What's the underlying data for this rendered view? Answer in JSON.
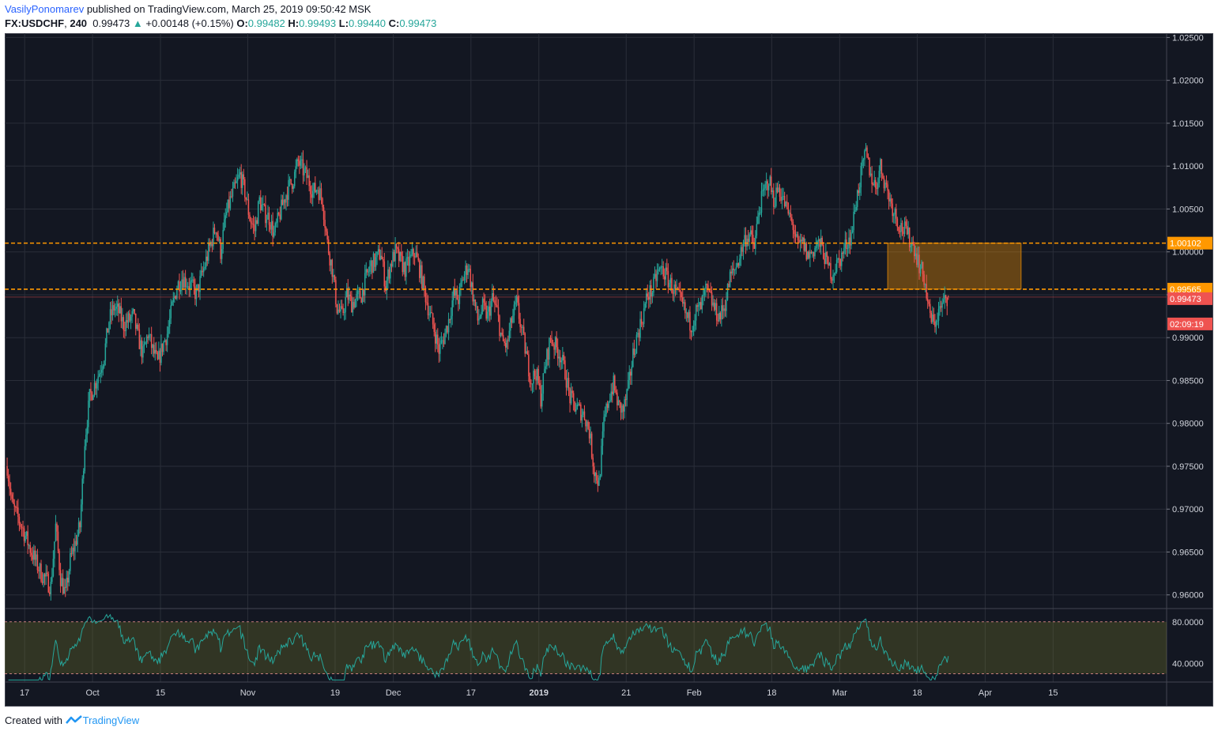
{
  "header": {
    "author": "VasilyPonomarev",
    "published_text": "published on TradingView.com, March 25, 2019 09:50:42 MSK",
    "symbol": "FX:USDCHF",
    "interval": "240",
    "last": "0.99473",
    "change_arrow": "▲",
    "change": "+0.00148 (+0.15%)",
    "open_label": "O:",
    "open": "0.99482",
    "high_label": "H:",
    "high": "0.99493",
    "low_label": "L:",
    "low": "0.99440",
    "close_label": "C:",
    "close": "0.99473"
  },
  "footer": {
    "created_with": "Created with",
    "brand": "TradingView"
  },
  "colors": {
    "background": "#131722",
    "up": "#26a69a",
    "down": "#ef5350",
    "level": "#ff9800",
    "grid": "#2a2e39",
    "axis_text": "#d1d4dc",
    "rsi_line": "#26a69a"
  },
  "chart_data": {
    "type": "candlestick",
    "symbol": "FX:USDCHF",
    "interval": "240",
    "ylim": [
      0.9585,
      1.0255
    ],
    "y_ticks": [
      "1.02500",
      "1.02000",
      "1.01500",
      "1.01000",
      "1.00500",
      "1.00000",
      "0.99500",
      "0.99000",
      "0.98500",
      "0.98000",
      "0.97500",
      "0.97000",
      "0.96500",
      "0.96000"
    ],
    "y_tick_values": [
      1.025,
      1.02,
      1.015,
      1.01,
      1.005,
      1.0,
      0.995,
      0.99,
      0.985,
      0.98,
      0.975,
      0.97,
      0.965,
      0.96
    ],
    "x_ticks": [
      {
        "label": "17",
        "t": 0.6
      },
      {
        "label": "Oct",
        "t": 14.6
      },
      {
        "label": "15",
        "t": 28.6
      },
      {
        "label": "Nov",
        "t": 46.6
      },
      {
        "label": "19",
        "t": 64.6
      },
      {
        "label": "Dec",
        "t": 76.6
      },
      {
        "label": "17",
        "t": 92.6
      },
      {
        "label": "2019",
        "t": 106.6,
        "bold": true
      },
      {
        "label": "21",
        "t": 124.6
      },
      {
        "label": "Feb",
        "t": 138.6
      },
      {
        "label": "18",
        "t": 154.6
      },
      {
        "label": "Mar",
        "t": 168.6
      },
      {
        "label": "18",
        "t": 184.6
      },
      {
        "label": "Apr",
        "t": 198.6
      },
      {
        "label": "15",
        "t": 212.6
      }
    ],
    "x_range": [
      -3.5,
      236
    ],
    "close_path": [
      [
        -3,
        0.975
      ],
      [
        -2,
        0.9705
      ],
      [
        0,
        0.968
      ],
      [
        2,
        0.965
      ],
      [
        4,
        0.9625
      ],
      [
        6,
        0.961
      ],
      [
        7,
        0.968
      ],
      [
        8,
        0.962
      ],
      [
        9,
        0.96
      ],
      [
        10,
        0.964
      ],
      [
        11,
        0.966
      ],
      [
        12,
        0.968
      ],
      [
        13,
        0.978
      ],
      [
        14,
        0.983
      ],
      [
        15,
        0.9845
      ],
      [
        16,
        0.986
      ],
      [
        17,
        0.988
      ],
      [
        18,
        0.992
      ],
      [
        19,
        0.9935
      ],
      [
        20,
        0.993
      ],
      [
        21,
        0.9915
      ],
      [
        22,
        0.992
      ],
      [
        23,
        0.9925
      ],
      [
        24,
        0.99
      ],
      [
        25,
        0.988
      ],
      [
        26,
        0.9905
      ],
      [
        27,
        0.9885
      ],
      [
        28,
        0.987
      ],
      [
        29,
        0.989
      ],
      [
        30,
        0.9905
      ],
      [
        31,
        0.9935
      ],
      [
        32,
        0.996
      ],
      [
        33,
        0.997
      ],
      [
        34,
        0.9965
      ],
      [
        35,
        0.996
      ],
      [
        36,
        0.995
      ],
      [
        37,
        0.997
      ],
      [
        38,
        0.999
      ],
      [
        39,
        1.001
      ],
      [
        40,
        1.003
      ],
      [
        41,
        1.0
      ],
      [
        42,
        1.004
      ],
      [
        43,
        1.006
      ],
      [
        44,
        1.0075
      ],
      [
        45,
        1.009
      ],
      [
        46,
        1.007
      ],
      [
        47,
        1.004
      ],
      [
        48,
        1.0025
      ],
      [
        49,
        1.006
      ],
      [
        50,
        1.0045
      ],
      [
        51,
        1.004
      ],
      [
        52,
        1.002
      ],
      [
        53,
        1.004
      ],
      [
        54,
        1.006
      ],
      [
        55,
        1.0075
      ],
      [
        56,
        1.0085
      ],
      [
        57,
        1.0105
      ],
      [
        58,
        1.0095
      ],
      [
        59,
        1.0085
      ],
      [
        60,
        1.007
      ],
      [
        61,
        1.0075
      ],
      [
        62,
        1.006
      ],
      [
        63,
        1.001
      ],
      [
        64,
        0.998
      ],
      [
        65,
        0.9935
      ],
      [
        66,
        0.9925
      ],
      [
        67,
        0.995
      ],
      [
        68,
        0.994
      ],
      [
        69,
        0.9945
      ],
      [
        70,
        0.995
      ],
      [
        71,
        0.997
      ],
      [
        72,
        0.9985
      ],
      [
        73,
        0.999
      ],
      [
        74,
        1.0
      ],
      [
        75,
        0.996
      ],
      [
        76,
        0.9985
      ],
      [
        77,
        1.0
      ],
      [
        78,
        0.999
      ],
      [
        79,
        0.998
      ],
      [
        80,
        0.999
      ],
      [
        81,
        1.0
      ],
      [
        82,
        0.998
      ],
      [
        83,
        0.9955
      ],
      [
        84,
        0.993
      ],
      [
        85,
        0.991
      ],
      [
        86,
        0.9885
      ],
      [
        87,
        0.99
      ],
      [
        88,
        0.992
      ],
      [
        89,
        0.995
      ],
      [
        90,
        0.9945
      ],
      [
        91,
        0.997
      ],
      [
        92,
        0.9985
      ],
      [
        93,
        0.995
      ],
      [
        94,
        0.992
      ],
      [
        95,
        0.9935
      ],
      [
        96,
        0.9925
      ],
      [
        97,
        0.9945
      ],
      [
        98,
        0.993
      ],
      [
        99,
        0.9895
      ],
      [
        100,
        0.989
      ],
      [
        101,
        0.992
      ],
      [
        102,
        0.994
      ],
      [
        103,
        0.991
      ],
      [
        104,
        0.988
      ],
      [
        105,
        0.985
      ],
      [
        106,
        0.986
      ],
      [
        107,
        0.983
      ],
      [
        108,
        0.987
      ],
      [
        109,
        0.99
      ],
      [
        110,
        0.989
      ],
      [
        111,
        0.988
      ],
      [
        112,
        0.986
      ],
      [
        113,
        0.983
      ],
      [
        114,
        0.982
      ],
      [
        115,
        0.9815
      ],
      [
        116,
        0.981
      ],
      [
        117,
        0.979
      ],
      [
        118,
        0.9745
      ],
      [
        119,
        0.973
      ],
      [
        120,
        0.98
      ],
      [
        121,
        0.983
      ],
      [
        122,
        0.9845
      ],
      [
        123,
        0.982
      ],
      [
        124,
        0.9815
      ],
      [
        125,
        0.984
      ],
      [
        126,
        0.988
      ],
      [
        127,
        0.9905
      ],
      [
        128,
        0.9925
      ],
      [
        129,
        0.995
      ],
      [
        130,
        0.9955
      ],
      [
        131,
        0.9975
      ],
      [
        132,
        0.998
      ],
      [
        133,
        0.997
      ],
      [
        134,
        0.996
      ],
      [
        135,
        0.995
      ],
      [
        136,
        0.994
      ],
      [
        137,
        0.9925
      ],
      [
        138,
        0.9915
      ],
      [
        139,
        0.993
      ],
      [
        140,
        0.9935
      ],
      [
        141,
        0.9955
      ],
      [
        142,
        0.9945
      ],
      [
        143,
        0.993
      ],
      [
        144,
        0.9925
      ],
      [
        145,
        0.994
      ],
      [
        146,
        0.997
      ],
      [
        147,
        0.998
      ],
      [
        148,
        0.9995
      ],
      [
        149,
        1.0015
      ],
      [
        150,
        1.002
      ],
      [
        151,
        1.0005
      ],
      [
        152,
        1.005
      ],
      [
        153,
        1.007
      ],
      [
        154,
        1.0085
      ],
      [
        155,
        1.006
      ],
      [
        156,
        1.0075
      ],
      [
        157,
        1.006
      ],
      [
        158,
        1.0045
      ],
      [
        159,
        1.003
      ],
      [
        160,
        1.0005
      ],
      [
        161,
        1.001
      ],
      [
        162,
        0.9995
      ],
      [
        163,
        1.0
      ],
      [
        164,
        1.001
      ],
      [
        165,
        1.0005
      ],
      [
        166,
        0.9985
      ],
      [
        167,
        0.9975
      ],
      [
        168,
        0.9985
      ],
      [
        169,
        0.9995
      ],
      [
        170,
        1.001
      ],
      [
        171,
        1.002
      ],
      [
        172,
        1.006
      ],
      [
        173,
        1.009
      ],
      [
        174,
        1.0115
      ],
      [
        175,
        1.009
      ],
      [
        176,
        1.0075
      ],
      [
        177,
        1.01
      ],
      [
        178,
        1.008
      ],
      [
        179,
        1.006
      ],
      [
        180,
        1.0045
      ],
      [
        181,
        1.003
      ],
      [
        182,
        1.0025
      ],
      [
        183,
        1.0015
      ],
      [
        184,
        1.0005
      ],
      [
        185,
        0.9985
      ],
      [
        186,
        0.997
      ],
      [
        187,
        0.993
      ],
      [
        188,
        0.9915
      ],
      [
        189,
        0.993
      ],
      [
        190,
        0.994
      ],
      [
        191,
        0.9947
      ]
    ],
    "levels": [
      {
        "value": 1.00102,
        "label": "1.00102",
        "color": "#ff9800"
      },
      {
        "value": 0.99565,
        "label": "0.99565",
        "color": "#ff9800"
      }
    ],
    "current_price": {
      "value": 0.99473,
      "label": "0.99473",
      "countdown": "02:09:19",
      "color": "#ef5350"
    },
    "zone": {
      "t_start": 178.5,
      "t_end": 206.0,
      "top": 1.00102,
      "bottom": 0.99565,
      "color": "#ff9800"
    },
    "rsi": {
      "upper_band": 80,
      "lower_band": 30,
      "ylim": [
        22,
        92
      ],
      "y_ticks": [
        "80.0000",
        "40.0000"
      ],
      "y_tick_values": [
        80,
        40
      ]
    }
  }
}
